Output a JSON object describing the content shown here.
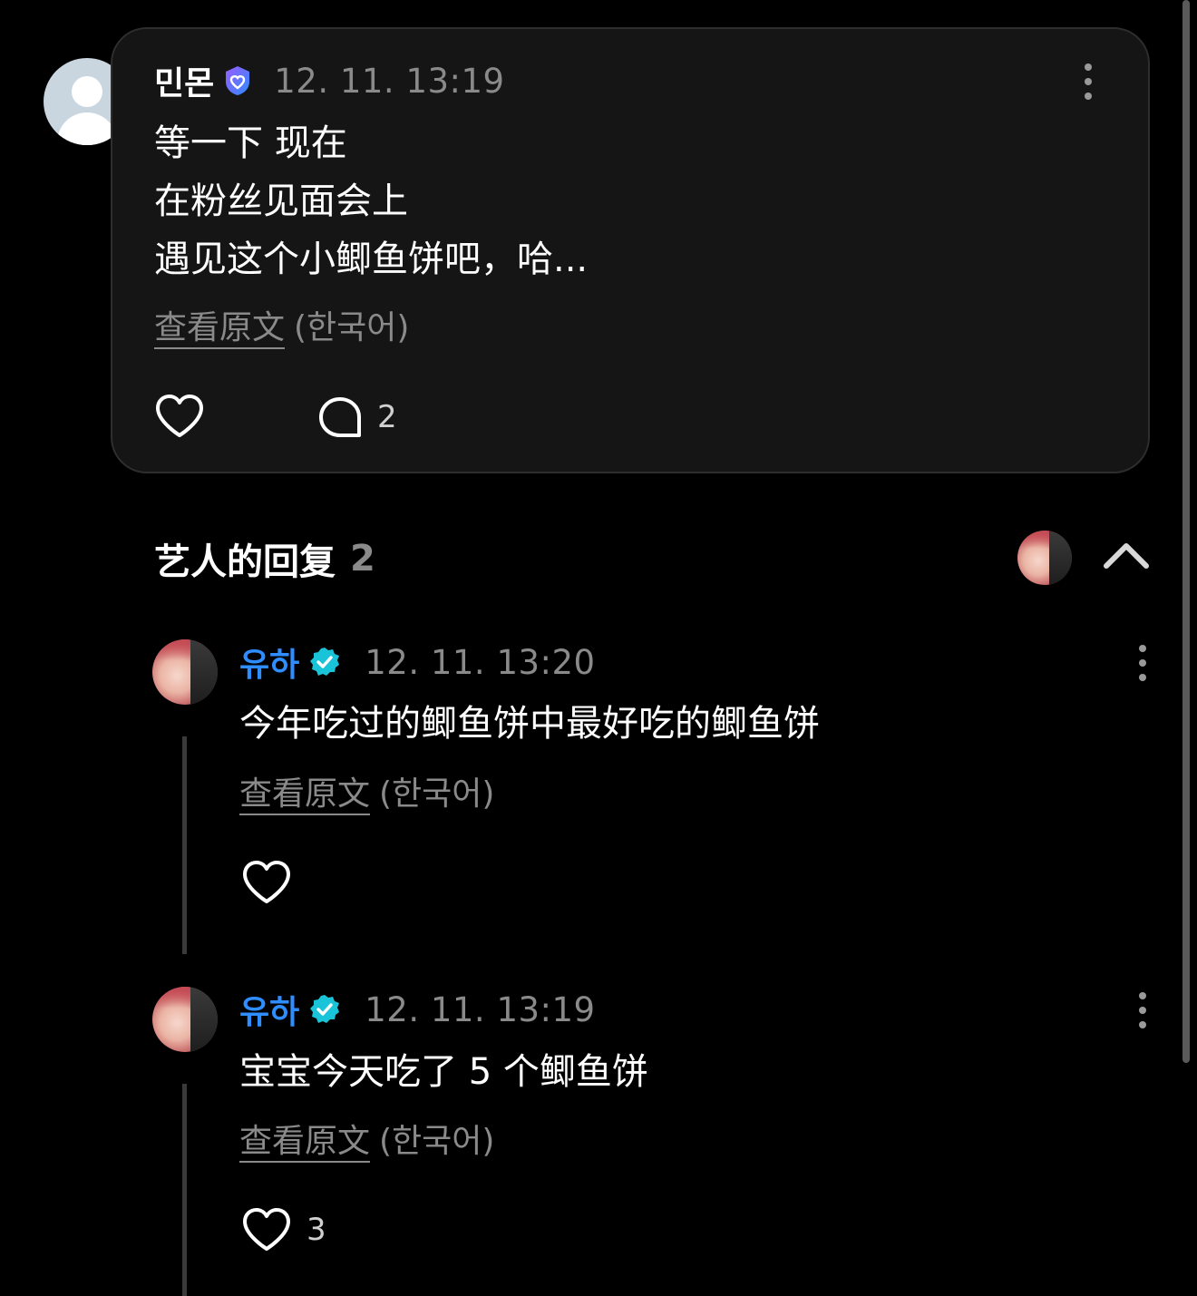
{
  "post": {
    "author": "민몬",
    "timestamp": "12. 11. 13:19",
    "body": "等一下 现在\n在粉丝见面会上\n遇见这个小鲫鱼饼吧，哈...",
    "translate_link": "查看原文",
    "translate_lang": "(한국어)",
    "comment_count": "2",
    "icons": [
      "avatar-default-icon",
      "verified-fan-badge-icon",
      "more-vertical-icon",
      "heart-icon",
      "comment-bubble-icon"
    ]
  },
  "replies_section": {
    "title": "艺人的回复",
    "count": "2",
    "icons": [
      "chevron-up-icon"
    ]
  },
  "replies": [
    {
      "author": "유하",
      "timestamp": "12. 11. 13:20",
      "body": "今年吃过的鲫鱼饼中最好吃的鲫鱼饼",
      "translate_link": "查看原文",
      "translate_lang": "(한국어)",
      "like_count": ""
    },
    {
      "author": "유하",
      "timestamp": "12. 11. 13:19",
      "body": "宝宝今天吃了 5 个鲫鱼饼",
      "translate_link": "查看原文",
      "translate_lang": "(한국어)",
      "like_count": "3"
    }
  ],
  "colors": {
    "background": "#000000",
    "card": "#151515",
    "artist_name": "#2e8dff",
    "artist_badge": "#19c3d8",
    "fan_badge": "#6b6bff",
    "muted": "#8a8a8a"
  }
}
